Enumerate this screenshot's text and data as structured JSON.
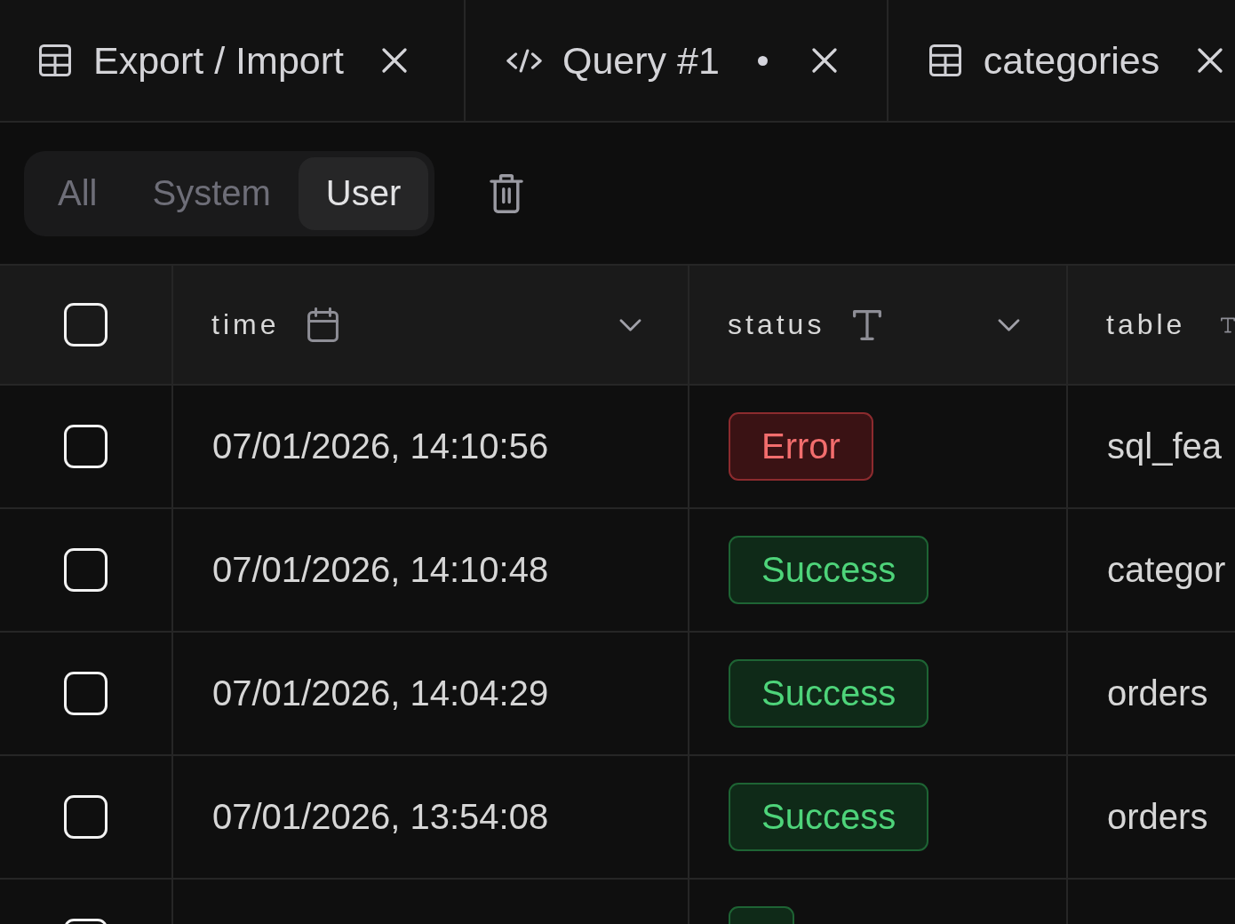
{
  "tabs": [
    {
      "kind": "table",
      "label": "Export / Import",
      "modified": false
    },
    {
      "kind": "query",
      "label": "Query #1",
      "modified": true
    },
    {
      "kind": "table",
      "label": "categories",
      "modified": false
    }
  ],
  "filter": {
    "options": [
      {
        "label": "All",
        "selected": false
      },
      {
        "label": "System",
        "selected": false
      },
      {
        "label": "User",
        "selected": true
      }
    ]
  },
  "table": {
    "header_checked": false,
    "columns": [
      {
        "label": "time",
        "kind": "date",
        "menu": true
      },
      {
        "label": "status",
        "kind": "text",
        "menu": true
      },
      {
        "label": "table",
        "kind": "text",
        "menu": false
      }
    ],
    "rows": [
      {
        "checked": false,
        "time": "07/01/2026, 14:10:56",
        "status": "Error",
        "kind": "error",
        "table": "sql_fea"
      },
      {
        "checked": false,
        "time": "07/01/2026, 14:10:48",
        "status": "Success",
        "kind": "success",
        "table": "categor"
      },
      {
        "checked": false,
        "time": "07/01/2026, 14:04:29",
        "status": "Success",
        "kind": "success",
        "table": "orders"
      },
      {
        "checked": false,
        "time": "07/01/2026, 13:54:08",
        "status": "Success",
        "kind": "success",
        "table": "orders"
      },
      {
        "checked": false,
        "kind": "success"
      }
    ]
  }
}
